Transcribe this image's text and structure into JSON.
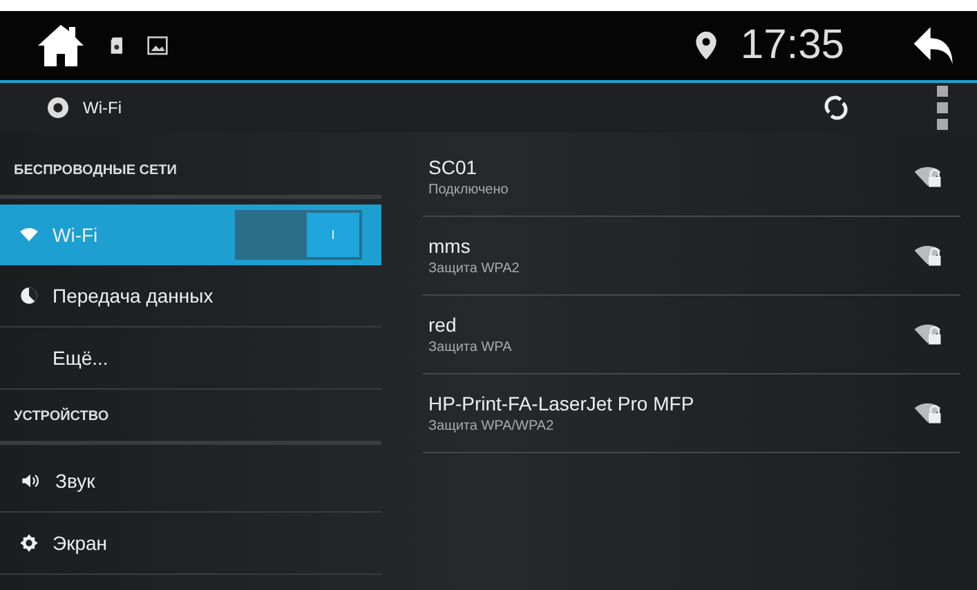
{
  "status_bar": {
    "time": "17:35"
  },
  "action_bar": {
    "title": "Wi-Fi"
  },
  "sidebar": {
    "items": [
      {
        "kind": "header",
        "label": "БЕСПРОВОДНЫЕ СЕТИ"
      },
      {
        "kind": "toggle",
        "label": "Wi-Fi",
        "selected": true,
        "on": true,
        "switch_label": "I"
      },
      {
        "kind": "item",
        "label": "Передача данных",
        "selected": false
      },
      {
        "kind": "item",
        "label": "Ещё...",
        "selected": false
      },
      {
        "kind": "header",
        "label": "УСТРОЙСТВО"
      },
      {
        "kind": "item",
        "label": "Звук",
        "selected": false
      },
      {
        "kind": "item",
        "label": "Экран",
        "selected": false
      }
    ]
  },
  "networks": [
    {
      "name": "SC01",
      "status": "Подключено"
    },
    {
      "name": "mms",
      "status": "Защита WPA2"
    },
    {
      "name": "red",
      "status": "Защита WPA"
    },
    {
      "name": "HP-Print-FA-LaserJet Pro MFP",
      "status": "Защита WPA/WPA2"
    }
  ]
}
